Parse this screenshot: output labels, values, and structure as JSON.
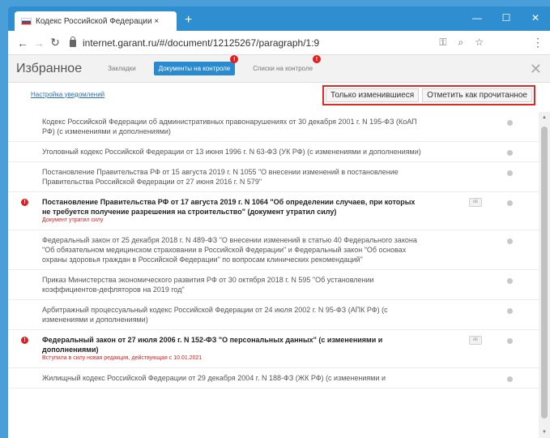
{
  "browser": {
    "tab_title": "Кодекс Российской Федерации ×",
    "tab_close": "✕",
    "new_tab": "+",
    "url": "internet.garant.ru/#/document/12125267/paragraph/1:9",
    "win_min": "—",
    "win_max": "☐",
    "win_close": "✕"
  },
  "app": {
    "title": "Избранное",
    "tabs": [
      {
        "label": "Закладки"
      },
      {
        "label": "Документы на контроле",
        "badge": "!"
      },
      {
        "label": "Списки на контроле",
        "badge": "!"
      }
    ],
    "close": "✕"
  },
  "toolbar": {
    "notif_link": "Настройка уведомлений",
    "btn_changed": "Только изменившиеся",
    "btn_mark_read": "Отметить как прочитанное"
  },
  "documents": [
    {
      "text": "Кодекс Российской Федерации об административных правонарушениях от 30 декабря 2001 г. N 195-ФЗ (КоАП РФ) (с изменениями и дополнениями)"
    },
    {
      "text": "Уголовный кодекс Российской Федерации от 13 июня 1996 г. N 63-ФЗ (УК РФ) (с изменениями и дополнениями)"
    },
    {
      "text": "Постановление Правительства РФ от 15 августа 2019 г. N 1055 \"О внесении изменений в постановление Правительства Российской Федерации от 27 июня 2016 г. N 579\""
    },
    {
      "text": "Постановление Правительства РФ от 17 августа 2019 г. N 1064 \"Об определении случаев, при которых не требуется получение разрешения на строительство\" (документ утратил силу)",
      "status": "Документ утратил силу",
      "important": true,
      "ok": "ok"
    },
    {
      "text": "Федеральный закон от 25 декабря 2018 г. N 489-ФЗ \"О внесении изменений в статью 40 Федерального закона \"Об обязательном медицинском страховании в Российской Федерации\" и Федеральный закон \"Об основах охраны здоровья граждан в Российской Федерации\" по вопросам клинических рекомендаций\""
    },
    {
      "text": "Приказ Министерства экономического развития РФ от 30 октября 2018 г. N 595 \"Об установлении коэффициентов-дефляторов на 2019 год\""
    },
    {
      "text": "Арбитражный процессуальный кодекс Российской Федерации от 24 июля 2002 г. N 95-ФЗ (АПК РФ) (с изменениями и дополнениями)"
    },
    {
      "text": "Федеральный закон от 27 июля 2006 г. N 152-ФЗ \"О персональных данных\" (с изменениями и дополнениями)",
      "status": "Вступила в силу новая редакция, действующая с 10.01.2021",
      "important": true,
      "ok": "ok"
    },
    {
      "text": "Жилищный кодекс Российской Федерации от 29 декабря 2004 г. N 188-ФЗ (ЖК РФ) (с изменениями и"
    }
  ]
}
